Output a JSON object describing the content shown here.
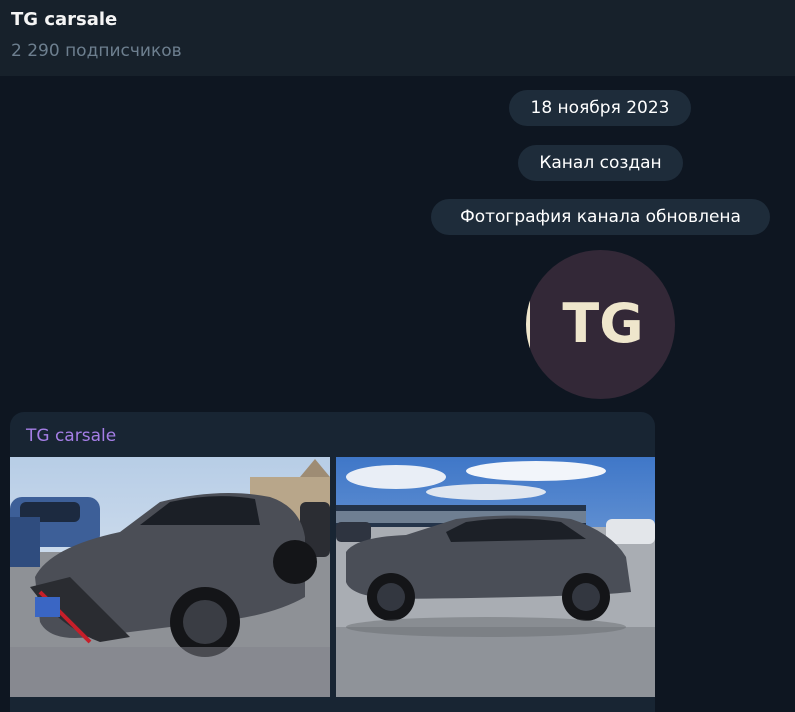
{
  "header": {
    "title": "TG carsale",
    "subscribers": "2 290 подписчиков"
  },
  "service_messages": {
    "date": "18 ноября 2023",
    "created": "Канал создан",
    "photo_updated": "Фотография канала обновлена"
  },
  "avatar": {
    "logo_text": "TG",
    "bg_color": "#332837",
    "text_color": "#efe6cc"
  },
  "post": {
    "author": "TG carsale",
    "photos": [
      "car-front-quarter-photo",
      "car-side-photo"
    ]
  },
  "colors": {
    "background": "#0e1621",
    "header": "#17212b",
    "pill": "#1e2c3a",
    "author_accent": "#a57ee6"
  }
}
